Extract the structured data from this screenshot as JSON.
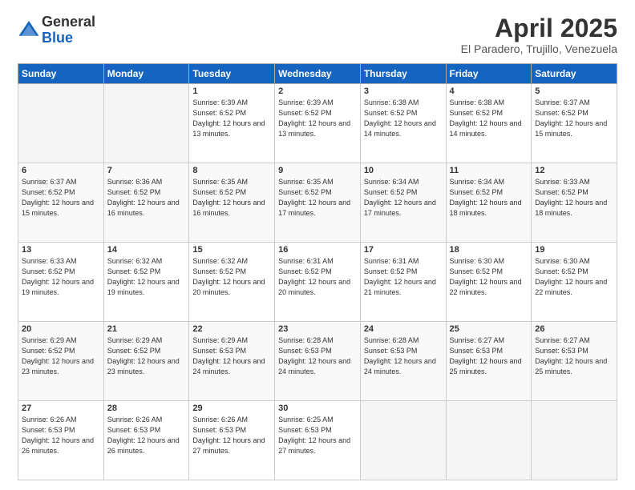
{
  "header": {
    "logo_general": "General",
    "logo_blue": "Blue",
    "month_title": "April 2025",
    "location": "El Paradero, Trujillo, Venezuela"
  },
  "days_of_week": [
    "Sunday",
    "Monday",
    "Tuesday",
    "Wednesday",
    "Thursday",
    "Friday",
    "Saturday"
  ],
  "weeks": [
    [
      {
        "day": "",
        "info": ""
      },
      {
        "day": "",
        "info": ""
      },
      {
        "day": "1",
        "info": "Sunrise: 6:39 AM\nSunset: 6:52 PM\nDaylight: 12 hours and 13 minutes."
      },
      {
        "day": "2",
        "info": "Sunrise: 6:39 AM\nSunset: 6:52 PM\nDaylight: 12 hours and 13 minutes."
      },
      {
        "day": "3",
        "info": "Sunrise: 6:38 AM\nSunset: 6:52 PM\nDaylight: 12 hours and 14 minutes."
      },
      {
        "day": "4",
        "info": "Sunrise: 6:38 AM\nSunset: 6:52 PM\nDaylight: 12 hours and 14 minutes."
      },
      {
        "day": "5",
        "info": "Sunrise: 6:37 AM\nSunset: 6:52 PM\nDaylight: 12 hours and 15 minutes."
      }
    ],
    [
      {
        "day": "6",
        "info": "Sunrise: 6:37 AM\nSunset: 6:52 PM\nDaylight: 12 hours and 15 minutes."
      },
      {
        "day": "7",
        "info": "Sunrise: 6:36 AM\nSunset: 6:52 PM\nDaylight: 12 hours and 16 minutes."
      },
      {
        "day": "8",
        "info": "Sunrise: 6:35 AM\nSunset: 6:52 PM\nDaylight: 12 hours and 16 minutes."
      },
      {
        "day": "9",
        "info": "Sunrise: 6:35 AM\nSunset: 6:52 PM\nDaylight: 12 hours and 17 minutes."
      },
      {
        "day": "10",
        "info": "Sunrise: 6:34 AM\nSunset: 6:52 PM\nDaylight: 12 hours and 17 minutes."
      },
      {
        "day": "11",
        "info": "Sunrise: 6:34 AM\nSunset: 6:52 PM\nDaylight: 12 hours and 18 minutes."
      },
      {
        "day": "12",
        "info": "Sunrise: 6:33 AM\nSunset: 6:52 PM\nDaylight: 12 hours and 18 minutes."
      }
    ],
    [
      {
        "day": "13",
        "info": "Sunrise: 6:33 AM\nSunset: 6:52 PM\nDaylight: 12 hours and 19 minutes."
      },
      {
        "day": "14",
        "info": "Sunrise: 6:32 AM\nSunset: 6:52 PM\nDaylight: 12 hours and 19 minutes."
      },
      {
        "day": "15",
        "info": "Sunrise: 6:32 AM\nSunset: 6:52 PM\nDaylight: 12 hours and 20 minutes."
      },
      {
        "day": "16",
        "info": "Sunrise: 6:31 AM\nSunset: 6:52 PM\nDaylight: 12 hours and 20 minutes."
      },
      {
        "day": "17",
        "info": "Sunrise: 6:31 AM\nSunset: 6:52 PM\nDaylight: 12 hours and 21 minutes."
      },
      {
        "day": "18",
        "info": "Sunrise: 6:30 AM\nSunset: 6:52 PM\nDaylight: 12 hours and 22 minutes."
      },
      {
        "day": "19",
        "info": "Sunrise: 6:30 AM\nSunset: 6:52 PM\nDaylight: 12 hours and 22 minutes."
      }
    ],
    [
      {
        "day": "20",
        "info": "Sunrise: 6:29 AM\nSunset: 6:52 PM\nDaylight: 12 hours and 23 minutes."
      },
      {
        "day": "21",
        "info": "Sunrise: 6:29 AM\nSunset: 6:52 PM\nDaylight: 12 hours and 23 minutes."
      },
      {
        "day": "22",
        "info": "Sunrise: 6:29 AM\nSunset: 6:53 PM\nDaylight: 12 hours and 24 minutes."
      },
      {
        "day": "23",
        "info": "Sunrise: 6:28 AM\nSunset: 6:53 PM\nDaylight: 12 hours and 24 minutes."
      },
      {
        "day": "24",
        "info": "Sunrise: 6:28 AM\nSunset: 6:53 PM\nDaylight: 12 hours and 24 minutes."
      },
      {
        "day": "25",
        "info": "Sunrise: 6:27 AM\nSunset: 6:53 PM\nDaylight: 12 hours and 25 minutes."
      },
      {
        "day": "26",
        "info": "Sunrise: 6:27 AM\nSunset: 6:53 PM\nDaylight: 12 hours and 25 minutes."
      }
    ],
    [
      {
        "day": "27",
        "info": "Sunrise: 6:26 AM\nSunset: 6:53 PM\nDaylight: 12 hours and 26 minutes."
      },
      {
        "day": "28",
        "info": "Sunrise: 6:26 AM\nSunset: 6:53 PM\nDaylight: 12 hours and 26 minutes."
      },
      {
        "day": "29",
        "info": "Sunrise: 6:26 AM\nSunset: 6:53 PM\nDaylight: 12 hours and 27 minutes."
      },
      {
        "day": "30",
        "info": "Sunrise: 6:25 AM\nSunset: 6:53 PM\nDaylight: 12 hours and 27 minutes."
      },
      {
        "day": "",
        "info": ""
      },
      {
        "day": "",
        "info": ""
      },
      {
        "day": "",
        "info": ""
      }
    ]
  ]
}
